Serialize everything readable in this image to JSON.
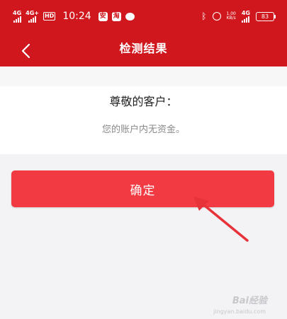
{
  "status_bar": {
    "network1": "4G",
    "network2": "4G+",
    "hd": "HD",
    "time": "10:24",
    "app1": "安",
    "app2": "淘",
    "speed_value": "1.00",
    "speed_unit": "KB/s",
    "network3": "4G",
    "battery": "83"
  },
  "header": {
    "title": "检测结果"
  },
  "content": {
    "greeting": "尊敬的客户：",
    "message": "您的账户内无资金。"
  },
  "actions": {
    "confirm_label": "确定"
  },
  "watermark": {
    "text": "Bai经验",
    "sub": "jingyan.baidu.com"
  },
  "colors": {
    "header_bg": "#d0171d",
    "button_bg": "#f23a42",
    "page_bg": "#f3f3f5",
    "arrow": "#e8323a"
  }
}
